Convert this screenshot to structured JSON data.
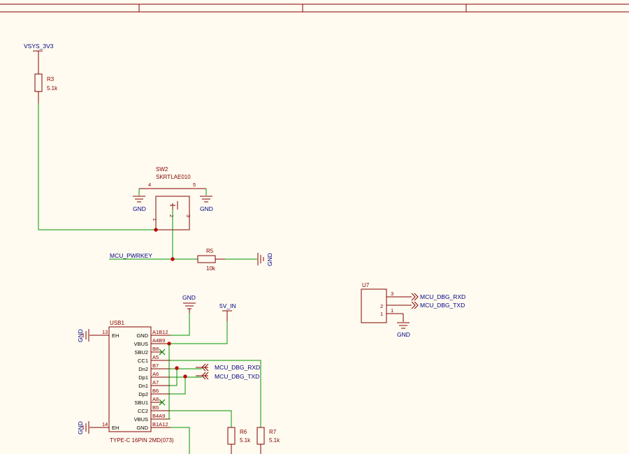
{
  "power": {
    "vsys": "VSYS_3V3",
    "gnd": "GND",
    "v5": "5V_IN"
  },
  "components": {
    "r3": {
      "ref": "R3",
      "value": "5.1k"
    },
    "r5": {
      "ref": "R5",
      "value": "10k"
    },
    "r6": {
      "ref": "R6",
      "value": "5.1k"
    },
    "r7": {
      "ref": "R7",
      "value": "5.1k"
    },
    "sw2": {
      "ref": "SW2",
      "value": "SKRTLAE010",
      "pins": [
        "1",
        "2",
        "3",
        "4",
        "5"
      ]
    },
    "u7": {
      "ref": "U7",
      "pins": [
        "3",
        "2",
        "1",
        "1"
      ]
    },
    "usb1": {
      "ref": "USB1",
      "value": "TYPE-C 16PIN 2MD(073)",
      "left_pins": [
        {
          "num": "13",
          "name": "EH"
        },
        {
          "num": "14",
          "name": "EH"
        }
      ],
      "right_pins": [
        {
          "num": "A1B12",
          "name": "GND"
        },
        {
          "num": "A4B9",
          "name": "VBUS"
        },
        {
          "num": "B8",
          "name": "SBU2"
        },
        {
          "num": "A5",
          "name": "CC1"
        },
        {
          "num": "B7",
          "name": "Dn2"
        },
        {
          "num": "A6",
          "name": "Dp1"
        },
        {
          "num": "A7",
          "name": "Dn1"
        },
        {
          "num": "B6",
          "name": "Dp2"
        },
        {
          "num": "A8",
          "name": "SBU1"
        },
        {
          "num": "B5",
          "name": "CC2"
        },
        {
          "num": "B4A9",
          "name": "VBUS"
        },
        {
          "num": "B1A12",
          "name": "GND"
        }
      ]
    }
  },
  "nets": {
    "pwrkey": "MCU_PWRKEY",
    "rxd": "MCU_DBG_RXD",
    "txd": "MCU_DBG_TXD"
  }
}
